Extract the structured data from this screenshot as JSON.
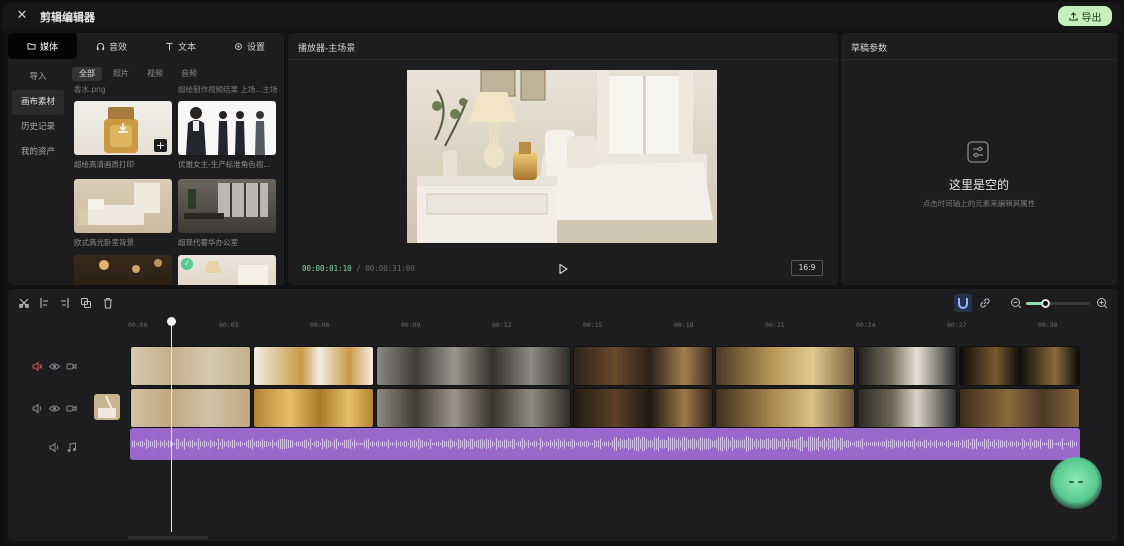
{
  "topbar": {
    "title": "剪辑编辑器",
    "export_label": "导出"
  },
  "media": {
    "tabs": [
      {
        "label": "媒体",
        "icon": "folder-icon"
      },
      {
        "label": "音效",
        "icon": "headphones-icon"
      },
      {
        "label": "文本",
        "icon": "text-icon"
      },
      {
        "label": "设置",
        "icon": "gear-icon"
      }
    ],
    "side_items": [
      "导入",
      "画布素材",
      "历史记录",
      "我的资产"
    ],
    "filters": [
      "全部",
      "照片",
      "视频",
      "音频"
    ],
    "scroll_labels": [
      "香水.png",
      "超绘制作视频结果 上场...主场"
    ],
    "items": [
      {
        "label": "超绘高清画质打印"
      },
      {
        "label": "优雅女主-生产标准角色视..."
      },
      {
        "label": "欧式高光卧室背景"
      },
      {
        "label": "超现代奢华办公室"
      }
    ]
  },
  "player": {
    "title": "播放器-主场景",
    "current_time": "00:00:01:10",
    "separator": "/",
    "total_time": "00:00:31:09",
    "ratio": "16:9"
  },
  "draft": {
    "title": "草稿参数",
    "empty_title": "这里是空的",
    "empty_desc": "点击时间轴上的元素来编辑其属性"
  },
  "timeline": {
    "ticks": [
      "00:00",
      "00:03",
      "00:06",
      "00:09",
      "00:12",
      "00:15",
      "00:18",
      "00:21",
      "00:24",
      "00:27",
      "00:30"
    ],
    "zoom_level": 0.3
  },
  "colors": {
    "accent": "#8fe0ad",
    "export_bg": "#c6f0b9",
    "audio": "#9a67cc",
    "timecode": "#7fd6a0"
  }
}
